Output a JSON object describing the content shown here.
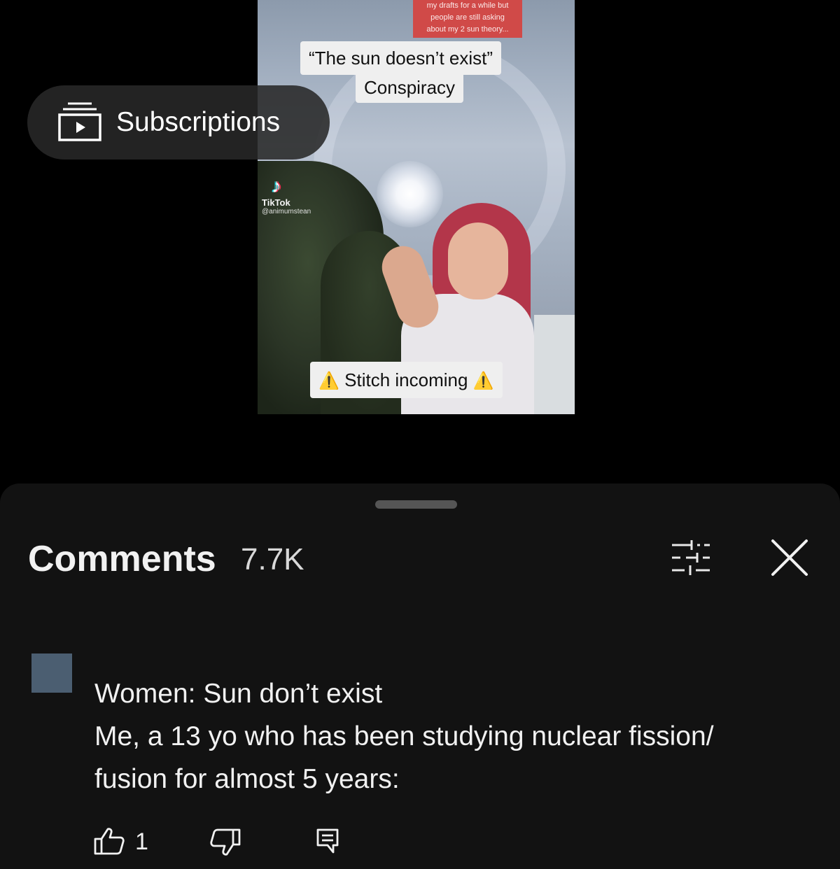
{
  "video": {
    "top_caption_lines": [
      "my drafts for a while but",
      "people are still asking",
      "about my 2 sun theory..."
    ],
    "caption_line1": "“The sun doesn’t exist”",
    "caption_line2": "Conspiracy",
    "caption_bottom": "Stitch incoming",
    "warning_glyph": "⚠️",
    "tiktok_brand": "TikTok",
    "tiktok_handle": "@animumstean"
  },
  "subscriptions": {
    "label": "Subscriptions",
    "icon": "subscriptions-icon"
  },
  "comments": {
    "title": "Comments",
    "count": "7.7K",
    "filter_icon": "sliders-icon",
    "close_icon": "close-icon",
    "items": [
      {
        "avatar_color": "#4b5e71",
        "lines": [
          "Women: Sun don’t exist",
          "Me, a 13 yo who has been studying nuclear fission/",
          "fusion for almost 5 years:"
        ],
        "like_count": "1"
      }
    ]
  },
  "colors": {
    "sheet_bg": "#121212",
    "page_bg": "#000000",
    "pill_bg": "#282828"
  }
}
